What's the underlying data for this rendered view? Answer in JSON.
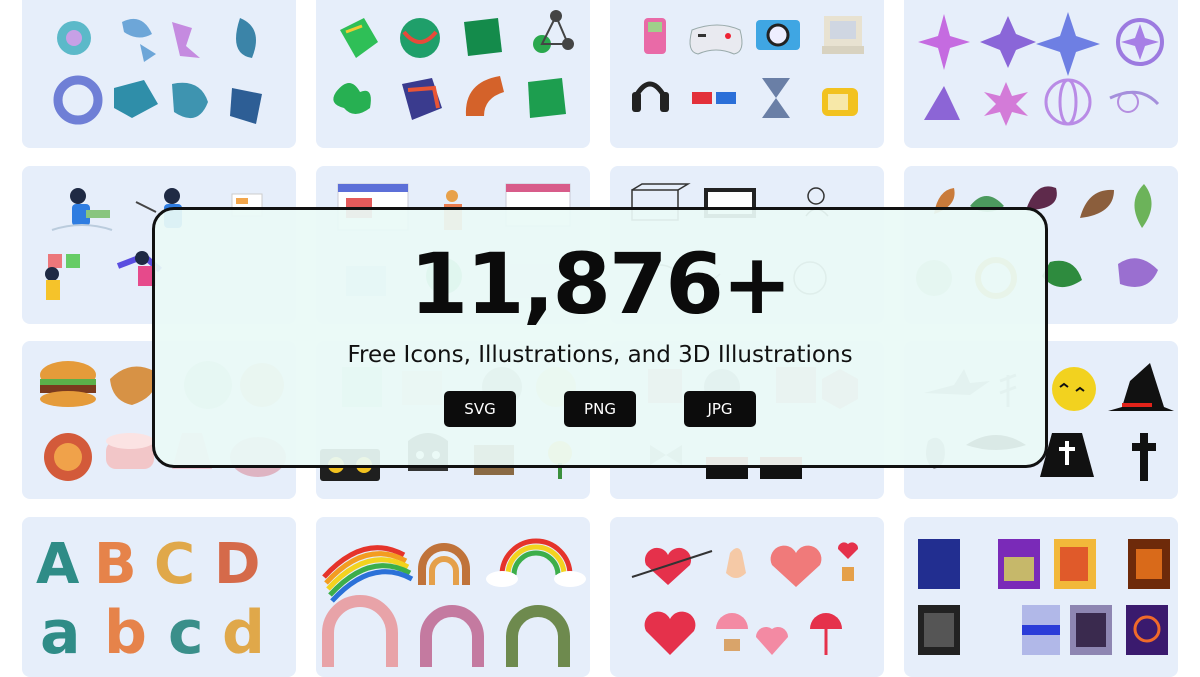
{
  "hero": {
    "count": "11,876+",
    "subtitle": "Free Icons, Illustrations, and 3D Illustrations"
  },
  "formats": [
    "SVG",
    "PNG",
    "JPG"
  ],
  "colors": {
    "card_background": "#e6eefa",
    "overlay_background": "#eafaf6",
    "badge_background": "#0c0c0c",
    "border": "#111111"
  },
  "pack_thumbnails": [
    {
      "name": "holographic-3d-shapes"
    },
    {
      "name": "iridescent-3d-objects"
    },
    {
      "name": "retro-3d-gadgets"
    },
    {
      "name": "chrome-star-sparkles"
    },
    {
      "name": "remote-work-people-illustrations"
    },
    {
      "name": "web-ui-illustrations"
    },
    {
      "name": "line-sketch-illustrations"
    },
    {
      "name": "leaves-and-plants"
    },
    {
      "name": "3d-food"
    },
    {
      "name": "retro-objects"
    },
    {
      "name": "sale-and-gifts"
    },
    {
      "name": "halloween-silhouettes"
    },
    {
      "name": "pattern-alphabet-letters"
    },
    {
      "name": "boho-rainbows"
    },
    {
      "name": "love-and-hearts"
    },
    {
      "name": "abstract-textures"
    }
  ]
}
